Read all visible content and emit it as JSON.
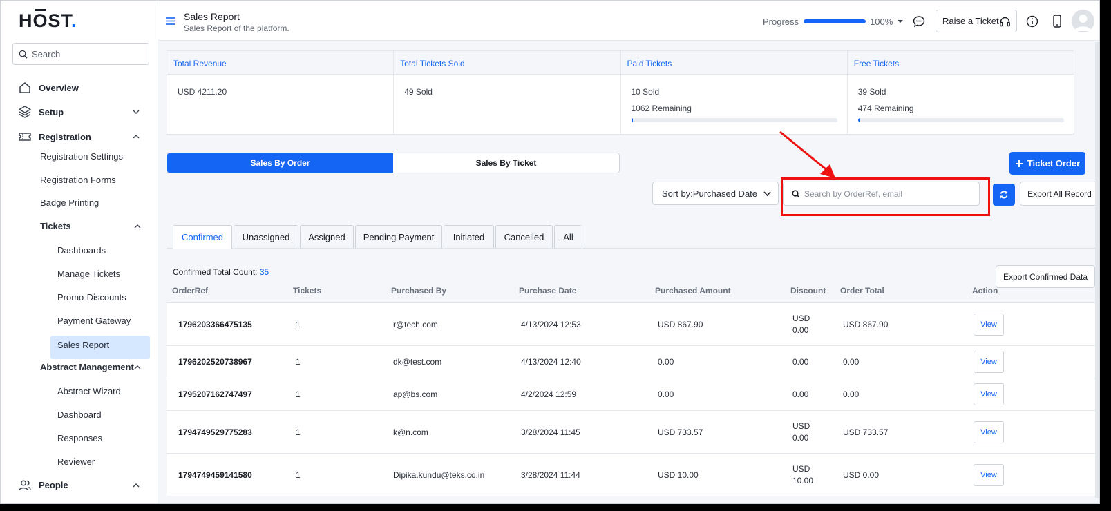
{
  "brand": {
    "logo_text_1": "H",
    "logo_text_o": "O",
    "logo_text_2": "ST",
    "logo_dot": "."
  },
  "sidebar": {
    "search_placeholder": "Search",
    "overview": "Overview",
    "setup": "Setup",
    "registration": "Registration",
    "registration_items": [
      "Registration Settings",
      "Registration Forms",
      "Badge Printing"
    ],
    "tickets": "Tickets",
    "ticket_items": [
      "Dashboards",
      "Manage Tickets",
      "Promo-Discounts",
      "Payment Gateway",
      "Sales Report"
    ],
    "abstract": "Abstract Management",
    "abstract_items": [
      "Abstract Wizard",
      "Dashboard",
      "Responses",
      "Reviewer"
    ],
    "people": "People"
  },
  "header": {
    "title": "Sales Report",
    "subtitle": "Sales Report of the platform.",
    "progress_label": "Progress",
    "progress_value": "100%",
    "progress_fraction": 1.0,
    "raise_ticket": "Raise a Ticket"
  },
  "stats": [
    {
      "title": "Total Revenue",
      "line1": "USD 4211.20",
      "line2": "",
      "bar": null
    },
    {
      "title": "Total Tickets Sold",
      "line1": "49 Sold",
      "line2": "",
      "bar": null
    },
    {
      "title": "Paid Tickets",
      "line1": "10 Sold",
      "line2": "1062 Remaining",
      "bar": 0.01
    },
    {
      "title": "Free Tickets",
      "line1": "39 Sold",
      "line2": "474 Remaining",
      "bar": 0.01
    }
  ],
  "segments": {
    "by_order": "Sales By Order",
    "by_ticket": "Sales By Ticket"
  },
  "toolbar": {
    "ticket_order": "Ticket Order",
    "sort_label": "Sort by:Purchased Date",
    "search_placeholder": "Search by OrderRef, email",
    "export_all": "Export All Record"
  },
  "tabs": [
    "Confirmed",
    "Unassigned",
    "Assigned",
    "Pending Payment",
    "Initiated",
    "Cancelled",
    "All"
  ],
  "count": {
    "label": "Confirmed Total Count:",
    "value": "35"
  },
  "export_confirmed": "Export Confirmed Data",
  "table": {
    "headers": [
      "OrderRef",
      "Tickets",
      "Purchased By",
      "Purchase Date",
      "Purchased Amount",
      "Discount",
      "Order Total",
      "Action"
    ],
    "rows": [
      {
        "ref": "1796203366475135",
        "tickets": "1",
        "by": "r@tech.com",
        "date": "4/13/2024 12:53",
        "amount": "USD 867.90",
        "discount_1": "USD",
        "discount_2": "0.00",
        "total": "USD 867.90",
        "action": "View"
      },
      {
        "ref": "1796202520738967",
        "tickets": "1",
        "by": "dk@test.com",
        "date": "4/13/2024 12:40",
        "amount": "0.00",
        "discount_1": "0.00",
        "discount_2": "",
        "total": "0.00",
        "action": "View"
      },
      {
        "ref": "1795207162747497",
        "tickets": "1",
        "by": "ap@bs.com",
        "date": "4/2/2024 12:59",
        "amount": "0.00",
        "discount_1": "0.00",
        "discount_2": "",
        "total": "0.00",
        "action": "View"
      },
      {
        "ref": "1794749529775283",
        "tickets": "1",
        "by": "k@n.com",
        "date": "3/28/2024 11:45",
        "amount": "USD 733.57",
        "discount_1": "USD",
        "discount_2": "0.00",
        "total": "USD 733.57",
        "action": "View"
      },
      {
        "ref": "1794749459141580",
        "tickets": "1",
        "by": "Dipika.kundu@teks.co.in",
        "date": "3/28/2024 11:44",
        "amount": "USD 10.00",
        "discount_1": "USD",
        "discount_2": "10.00",
        "total": "USD 0.00",
        "action": "View"
      }
    ]
  },
  "colors": {
    "accent": "#1565f5",
    "highlight": "#ee1111",
    "active_nav_bg": "#d6e8ff"
  }
}
